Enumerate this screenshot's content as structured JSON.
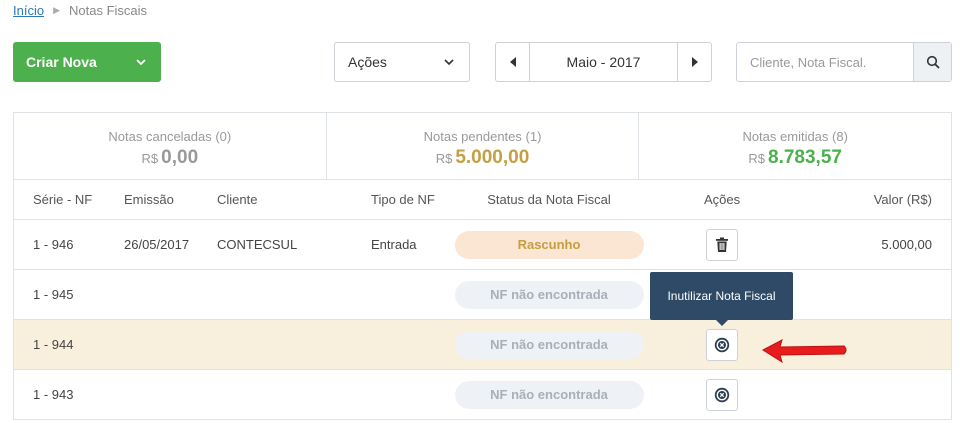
{
  "breadcrumb": {
    "home": "Início",
    "current": "Notas Fiscais"
  },
  "toolbar": {
    "create_label": "Criar Nova",
    "actions_label": "Ações",
    "month_label": "Maio - 2017",
    "search_placeholder": "Cliente, Nota Fiscal."
  },
  "summary": [
    {
      "caption": "Notas canceladas (0)",
      "currency": "R$",
      "value": "0,00",
      "color": "#999999"
    },
    {
      "caption": "Notas pendentes (1)",
      "currency": "R$",
      "value": "5.000,00",
      "color": "#c4a043"
    },
    {
      "caption": "Notas emitidas (8)",
      "currency": "R$",
      "value": "8.783,57",
      "color": "#4cb04c"
    }
  ],
  "table": {
    "headers": {
      "nf": "Série - NF",
      "emission": "Emissão",
      "client": "Cliente",
      "type": "Tipo de NF",
      "status": "Status da Nota Fiscal",
      "actions": "Ações",
      "value": "Valor (R$)"
    },
    "rows": [
      {
        "nf": "1 - 946",
        "emission": "26/05/2017",
        "client": "CONTECSUL",
        "type": "Entrada",
        "status": "Rascunho",
        "value": "5.000,00",
        "action_icon": "trash-icon"
      },
      {
        "nf": "1 - 945",
        "emission": "",
        "client": "",
        "type": "",
        "status": "NF não encontrada",
        "value": "",
        "action_icon": "cancel-icon"
      },
      {
        "nf": "1 - 944",
        "emission": "",
        "client": "",
        "type": "",
        "status": "NF não encontrada",
        "value": "",
        "action_icon": "cancel-icon"
      },
      {
        "nf": "1 - 943",
        "emission": "",
        "client": "",
        "type": "",
        "status": "NF não encontrada",
        "value": "",
        "action_icon": "cancel-icon"
      }
    ]
  },
  "tooltip": "Inutilizar Nota Fiscal",
  "colors": {
    "primary_green": "#4cb04c",
    "link_blue": "#2a7ab8",
    "tooltip_bg": "#2e4a66",
    "highlight_row": "#f8f0dd",
    "arrow_red": "#e81c1c"
  }
}
